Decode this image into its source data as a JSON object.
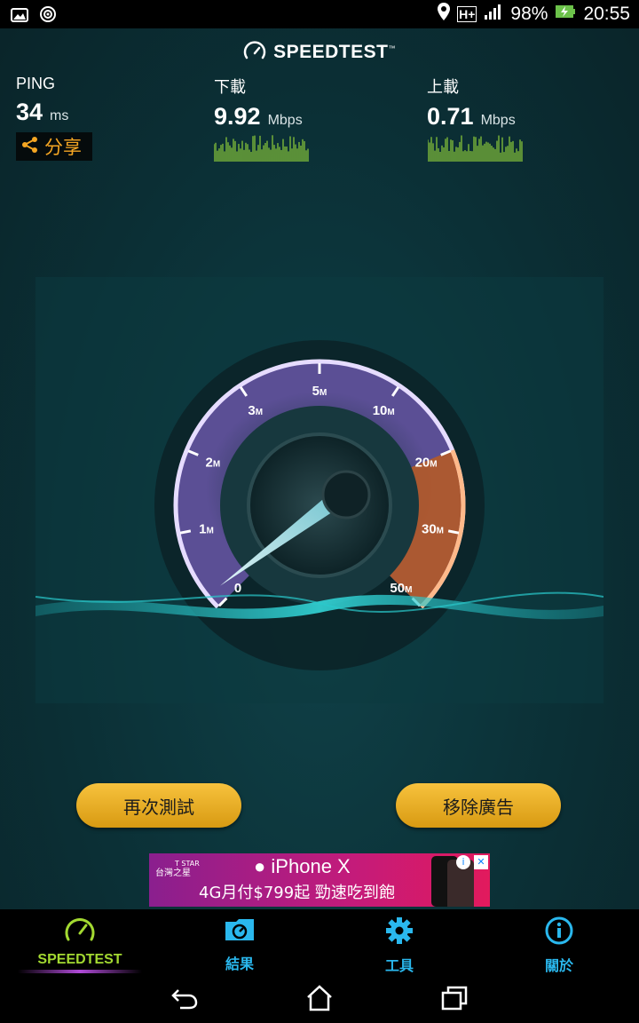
{
  "status_bar": {
    "battery": "98%",
    "time": "20:55",
    "network": "H+"
  },
  "header": {
    "title": "SPEEDTEST",
    "trademark": "™"
  },
  "metrics": {
    "ping": {
      "label": "PING",
      "value": "34",
      "unit": "ms"
    },
    "download": {
      "label": "下載",
      "value": "9.92",
      "unit": "Mbps"
    },
    "upload": {
      "label": "上載",
      "value": "0.71",
      "unit": "Mbps"
    }
  },
  "share": {
    "label": "分享"
  },
  "gauge": {
    "current_mbps": 0,
    "ticks": [
      {
        "value": "0",
        "unit": ""
      },
      {
        "value": "1",
        "unit": "M"
      },
      {
        "value": "2",
        "unit": "M"
      },
      {
        "value": "3",
        "unit": "M"
      },
      {
        "value": "5",
        "unit": "M"
      },
      {
        "value": "10",
        "unit": "M"
      },
      {
        "value": "20",
        "unit": "M"
      },
      {
        "value": "30",
        "unit": "M"
      },
      {
        "value": "50",
        "unit": "M"
      }
    ]
  },
  "actions": {
    "retest": "再次測試",
    "remove_ads": "移除廣告"
  },
  "ad": {
    "brand_line1": "T STAR",
    "brand_line2": "台灣之星",
    "headline": "iPhone X",
    "offer": "4G月付$799起 勁速吃到飽"
  },
  "nav": {
    "items": [
      {
        "label": "SPEEDTEST",
        "icon": "speedometer-icon",
        "active": true
      },
      {
        "label": "結果",
        "icon": "results-folder-icon",
        "active": false
      },
      {
        "label": "工具",
        "icon": "gear-icon",
        "active": false
      },
      {
        "label": "關於",
        "icon": "info-icon",
        "active": false
      }
    ]
  },
  "colors": {
    "accent_orange": "#f5a623",
    "nav_blue": "#2ab8ee",
    "active_green": "#a3d931",
    "button_gold": "#e9ad25",
    "gauge_orange": "#c8652a"
  }
}
